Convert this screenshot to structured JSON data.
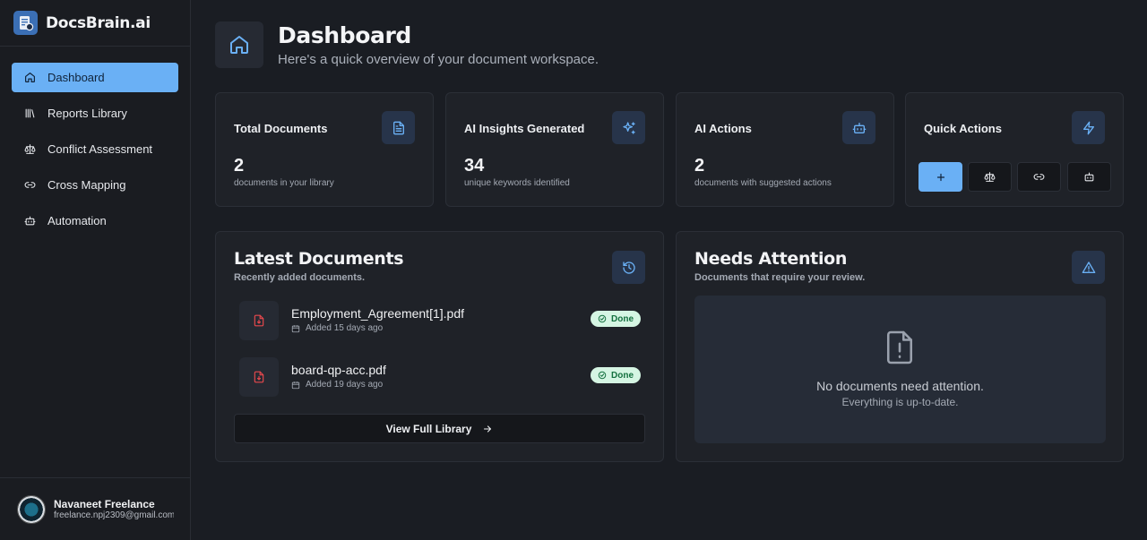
{
  "app": {
    "name": "DocsBrain.ai"
  },
  "nav": [
    {
      "label": "Dashboard",
      "icon": "home-icon",
      "active": true
    },
    {
      "label": "Reports Library",
      "icon": "library-icon",
      "active": false
    },
    {
      "label": "Conflict Assessment",
      "icon": "scale-icon",
      "active": false
    },
    {
      "label": "Cross Mapping",
      "icon": "link-icon",
      "active": false
    },
    {
      "label": "Automation",
      "icon": "bot-icon",
      "active": false
    }
  ],
  "user": {
    "name": "Navaneet Freelance",
    "email": "freelance.npj2309@gmail.com"
  },
  "header": {
    "title": "Dashboard",
    "subtitle": "Here's a quick overview of your document workspace."
  },
  "stats": [
    {
      "title": "Total Documents",
      "value": "2",
      "desc": "documents in your library",
      "icon": "file-text-icon"
    },
    {
      "title": "AI Insights Generated",
      "value": "34",
      "desc": "unique keywords identified",
      "icon": "sparkles-icon"
    },
    {
      "title": "AI Actions",
      "value": "2",
      "desc": "documents with suggested actions",
      "icon": "bot-icon"
    }
  ],
  "quick_actions": {
    "title": "Quick Actions",
    "icon": "zap-icon",
    "buttons": [
      "plus-icon",
      "scale-icon",
      "link-icon",
      "bot-icon"
    ]
  },
  "latest": {
    "title": "Latest Documents",
    "subtitle": "Recently added documents.",
    "icon": "history-icon",
    "docs": [
      {
        "name": "Employment_Agreement[1].pdf",
        "date": "Added 15 days ago",
        "status": "Done"
      },
      {
        "name": "board-qp-acc.pdf",
        "date": "Added 19 days ago",
        "status": "Done"
      }
    ],
    "view_all": "View Full Library"
  },
  "attention": {
    "title": "Needs Attention",
    "subtitle": "Documents that require your review.",
    "icon": "alert-triangle-icon",
    "empty_title": "No documents need attention.",
    "empty_sub": "Everything is up-to-date."
  },
  "colors": {
    "accent": "#6ab0f5",
    "background": "#1a1d23",
    "card": "#1f2228",
    "success_bg": "#d5f5e3",
    "success_text": "#14703f",
    "pdf_red": "#e5484d"
  }
}
